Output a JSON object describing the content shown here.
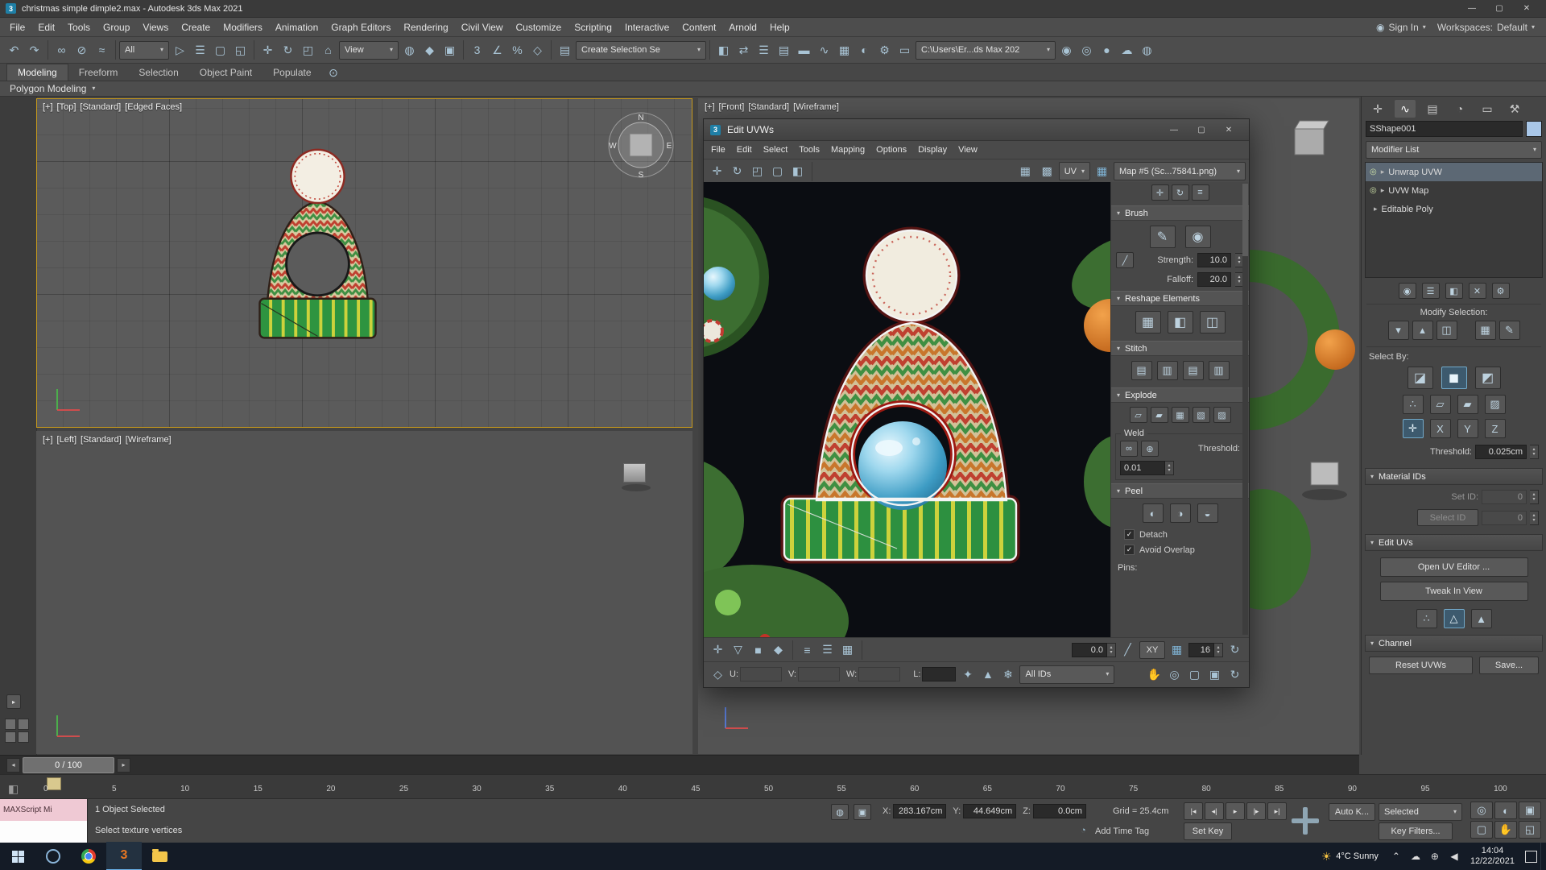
{
  "ui": {
    "caret": "▾",
    "caret_right": "▸",
    "check": "✓",
    "spin_up": "▴",
    "spin_down": "▾"
  },
  "window": {
    "title": "christmas simple dimple2.max - Autodesk 3ds Max 2021",
    "app_glyph": "3",
    "minimize": "—",
    "maximize": "▢",
    "close": "✕"
  },
  "menubar": {
    "items": [
      "File",
      "Edit",
      "Tools",
      "Group",
      "Views",
      "Create",
      "Modifiers",
      "Animation",
      "Graph Editors",
      "Rendering",
      "Civil View",
      "Customize",
      "Scripting",
      "Interactive",
      "Content",
      "Arnold",
      "Help"
    ],
    "sign_in": "Sign In",
    "sign_in_glyph": "◉",
    "workspaces_label": "Workspaces:",
    "workspaces_value": "Default"
  },
  "toolbar": {
    "icons_a": [
      {
        "n": "undo-icon",
        "g": "↶"
      },
      {
        "n": "redo-icon",
        "g": "↷"
      }
    ],
    "icons_b": [
      {
        "n": "select-and-link-icon",
        "g": "∞"
      },
      {
        "n": "unlink-selection-icon",
        "g": "⊘"
      },
      {
        "n": "bind-to-space-warp-icon",
        "g": "≈"
      }
    ],
    "filter_value": "All",
    "icons_c": [
      {
        "n": "select-object-icon",
        "g": "▷"
      },
      {
        "n": "select-by-name-icon",
        "g": "☰"
      },
      {
        "n": "rectangular-selection-icon",
        "g": "▢"
      },
      {
        "n": "window-crossing-icon",
        "g": "◱"
      }
    ],
    "icons_d": [
      {
        "n": "select-and-move-icon",
        "g": "✛"
      },
      {
        "n": "select-and-rotate-icon",
        "g": "↻"
      },
      {
        "n": "select-and-scale-icon",
        "g": "◰"
      },
      {
        "n": "select-and-place-icon",
        "g": "⌂"
      }
    ],
    "coord_value": "View",
    "icons_e": [
      {
        "n": "use-pivot-center-icon",
        "g": "◍"
      },
      {
        "n": "select-and-manipulate-icon",
        "g": "◆"
      },
      {
        "n": "keyboard-override-icon",
        "g": "▣"
      }
    ],
    "icons_f": [
      {
        "n": "snaps-toggle-icon",
        "g": "3"
      },
      {
        "n": "angle-snap-icon",
        "g": "∠"
      },
      {
        "n": "percent-snap-icon",
        "g": "%"
      },
      {
        "n": "spinner-snap-icon",
        "g": "◇"
      }
    ],
    "icons_g": [
      {
        "n": "named-selection-sets-icon",
        "g": "▤"
      }
    ],
    "selection_set_value": "Create Selection Se",
    "icons_h": [
      {
        "n": "mirror-icon",
        "g": "◧"
      },
      {
        "n": "align-icon",
        "g": "⇄"
      },
      {
        "n": "scene-explorer-icon",
        "g": "☰"
      },
      {
        "n": "layer-explorer-icon",
        "g": "▤"
      },
      {
        "n": "ribbon-toggle-icon",
        "g": "▬"
      },
      {
        "n": "curve-editor-icon",
        "g": "∿"
      },
      {
        "n": "schematic-view-icon",
        "g": "▦"
      },
      {
        "n": "material-editor-icon",
        "g": "◐"
      },
      {
        "n": "render-setup-icon",
        "g": "⚙"
      },
      {
        "n": "rendered-frame-icon",
        "g": "▭"
      }
    ],
    "project_path": "C:\\Users\\Er...ds Max 202",
    "icons_i": [
      {
        "n": "render-production-icon",
        "g": "◉"
      },
      {
        "n": "render-iterative-icon",
        "g": "◎"
      },
      {
        "n": "activeshade-icon",
        "g": "●"
      },
      {
        "n": "render-in-cloud-icon",
        "g": "☁"
      },
      {
        "n": "arnold-render-icon",
        "g": "◍"
      }
    ]
  },
  "ribbon": {
    "tabs": [
      {
        "label": "Modeling",
        "on": true
      },
      {
        "label": "Freeform",
        "on": false
      },
      {
        "label": "Selection",
        "on": false
      },
      {
        "label": "Object Paint",
        "on": false
      },
      {
        "label": "Populate",
        "on": false
      }
    ],
    "config_glyph": "⊙",
    "panel_title": "Polygon Modeling"
  },
  "viewports": {
    "top": [
      "[+]",
      "[Top]",
      "[Standard]",
      "[Edged Faces]"
    ],
    "left": [
      "[+]",
      "[Left]",
      "[Standard]",
      "[Wireframe]"
    ],
    "front": [
      "[+]",
      "[Front]",
      "[Standard]",
      "[Wireframe]"
    ],
    "viewcube": {
      "n": "N",
      "s": "S",
      "e": "E",
      "w": "W"
    }
  },
  "uv_editor": {
    "title": "Edit UVWs",
    "app_glyph": "3",
    "menu": [
      "File",
      "Edit",
      "Select",
      "Tools",
      "Mapping",
      "Options",
      "Display",
      "View"
    ],
    "toolbar_left": [
      {
        "n": "move-icon",
        "g": "✛"
      },
      {
        "n": "rotate-icon",
        "g": "↻"
      },
      {
        "n": "scale-icon",
        "g": "◰"
      },
      {
        "n": "freeform-gizmo-icon",
        "g": "▢"
      },
      {
        "n": "mirror-icon",
        "g": "◧"
      }
    ],
    "toolbar_right": [
      {
        "n": "show-map-toggle-icon",
        "g": "▦"
      },
      {
        "n": "tile-bitmap-icon",
        "g": "▩"
      }
    ],
    "uv_label": "UV",
    "checker_glyph": "▦",
    "map_value": "Map #5 (Sc...75841.png)",
    "panel": {
      "top_icons": [
        {
          "n": "align-horizontal-icon",
          "g": "✛"
        },
        {
          "n": "align-rotate-icon",
          "g": "↻"
        },
        {
          "n": "linear-align-icon",
          "g": "≡"
        }
      ],
      "brush_title": "Brush",
      "brush_icons": [
        {
          "n": "paint-move-brush-icon",
          "g": "✎"
        },
        {
          "n": "relax-brush-icon",
          "g": "◉"
        }
      ],
      "mirror_axis_glyph": "╱",
      "strength_label": "Strength:",
      "strength_value": "10.0",
      "falloff_label": "Falloff:",
      "falloff_value": "20.0",
      "reshape_title": "Reshape Elements",
      "reshape_icons": [
        {
          "n": "straighten-selection-icon",
          "g": "▦"
        },
        {
          "n": "make-rectangular-icon",
          "g": "◧"
        },
        {
          "n": "relax-element-icon",
          "g": "◫"
        }
      ],
      "stitch_title": "Stitch",
      "stitch_icons": [
        {
          "n": "stitch-custom-icon",
          "g": "▤"
        },
        {
          "n": "stitch-to-source-icon",
          "g": "▥"
        },
        {
          "n": "stitch-to-average-icon",
          "g": "▤"
        },
        {
          "n": "stitch-to-target-icon",
          "g": "▥"
        }
      ],
      "explode_title": "Explode",
      "explode_icons": [
        {
          "n": "flatten-by-angle-icon",
          "g": "▱"
        },
        {
          "n": "flatten-polygons-icon",
          "g": "▰"
        },
        {
          "n": "flatten-by-smoothing-icon",
          "g": "▦"
        },
        {
          "n": "flatten-by-material-icon",
          "g": "▧"
        },
        {
          "n": "explode-custom-icon",
          "g": "▨"
        }
      ],
      "weld_title": "Weld",
      "weld_icons": [
        {
          "n": "weld-selected-icon",
          "g": "∞"
        },
        {
          "n": "target-weld-icon",
          "g": "⊕"
        }
      ],
      "weld_threshold_label": "Threshold:",
      "weld_value": "0.01",
      "peel_title": "Peel",
      "peel_icons": [
        {
          "n": "quick-peel-icon",
          "g": "◐"
        },
        {
          "n": "peel-mode-icon",
          "g": "◑"
        },
        {
          "n": "pelt-map-icon",
          "g": "◒"
        }
      ],
      "detach_label": "Detach",
      "avoid_overlap_label": "Avoid Overlap",
      "pins_label": "Pins:"
    },
    "bottom1": {
      "icons_a": [
        {
          "n": "uvw-transform-gizmo-icon",
          "g": "✛"
        },
        {
          "n": "soft-selection-icon",
          "g": "▽"
        },
        {
          "n": "falloff-space-icon",
          "g": "■"
        },
        {
          "n": "falloff-type-icon",
          "g": "◆"
        }
      ],
      "icons_b": [
        {
          "n": "align-to-edge-icon",
          "g": "≡"
        },
        {
          "n": "distribute-icon",
          "g": "☰"
        },
        {
          "n": "pack-uvs-icon",
          "g": "▦"
        }
      ],
      "value": "0.0",
      "icons_c": [
        {
          "n": "edge-loop-mode-icon",
          "g": "╱"
        }
      ],
      "xy_label": "XY",
      "icons_d": [
        {
          "n": "grid-toggle-icon",
          "g": "▦"
        }
      ],
      "grid_value": "16",
      "icons_e": [
        {
          "n": "update-options-icon",
          "g": "↻"
        }
      ]
    },
    "bottom2": {
      "typein_glyph": "◇",
      "u_label": "U:",
      "u_value": "",
      "v_label": "V:",
      "v_value": "",
      "w_label": "W:",
      "w_value": "",
      "l_label": "L:",
      "l_value": "",
      "icons": [
        {
          "n": "lock-selection-icon",
          "g": "✦"
        },
        {
          "n": "filter-selected-faces-icon",
          "g": "▲"
        },
        {
          "n": "freeze-display-icon",
          "g": "❄"
        }
      ],
      "all_ids_value": "All IDs",
      "nav_icons": [
        {
          "n": "pan-hand-icon",
          "g": "✋"
        },
        {
          "n": "zoom-icon",
          "g": "◎"
        },
        {
          "n": "zoom-region-icon",
          "g": "▢"
        },
        {
          "n": "zoom-extents-icon",
          "g": "▣"
        },
        {
          "n": "zoom-to-selected-icon",
          "g": "↻"
        }
      ]
    }
  },
  "command_panel": {
    "tabs": [
      {
        "n": "create-tab-icon",
        "g": "✛",
        "on": false
      },
      {
        "n": "modify-tab-icon",
        "g": "∿",
        "on": true
      },
      {
        "n": "hierarchy-tab-icon",
        "g": "▤",
        "on": false
      },
      {
        "n": "motion-tab-icon",
        "g": "◔",
        "on": false
      },
      {
        "n": "display-tab-icon",
        "g": "▭",
        "on": false
      },
      {
        "n": "utilities-tab-icon",
        "g": "⚒",
        "on": false
      }
    ],
    "object_name": "SShape001",
    "modifier_list_label": "Modifier List",
    "stack": [
      {
        "label": "Unwrap UVW",
        "eye": "◎",
        "arrow": "▸",
        "on": true
      },
      {
        "label": "UVW Map",
        "eye": "◎",
        "arrow": "▸",
        "on": false
      },
      {
        "label": "Editable Poly",
        "eye": "",
        "arrow": "▸",
        "on": false
      }
    ],
    "stack_buttons": [
      {
        "n": "pin-stack-icon",
        "g": "◉"
      },
      {
        "n": "show-end-result-icon",
        "g": "☰"
      },
      {
        "n": "make-unique-icon",
        "g": "◧"
      },
      {
        "n": "remove-modifier-icon",
        "g": "✕"
      },
      {
        "n": "configure-modifier-sets-icon",
        "g": "⚙"
      }
    ],
    "modify_selection_label": "Modify Selection:",
    "modsel_icons_a": [
      {
        "n": "shrink-selection-icon",
        "g": "▾"
      },
      {
        "n": "grow-selection-icon",
        "g": "▴"
      },
      {
        "n": "ring-selection-icon",
        "g": "◫"
      }
    ],
    "modsel_icons_b": [
      {
        "n": "loop-selection-icon",
        "g": "▦"
      },
      {
        "n": "paint-select-icon",
        "g": "✎"
      }
    ],
    "select_by_label": "Select By:",
    "selby_row1": [
      {
        "n": "ignore-backfacing-icon",
        "g": "◪",
        "on": false
      },
      {
        "n": "select-element-cube-icon",
        "g": "◼",
        "on": true
      },
      {
        "n": "planar-angle-icon",
        "g": "◩",
        "on": false
      }
    ],
    "selby_row2": [
      {
        "n": "select-vertex-icon",
        "g": "∴",
        "on": false
      },
      {
        "n": "select-edge-icon",
        "g": "▱",
        "on": false
      },
      {
        "n": "select-polygon-icon",
        "g": "▰",
        "on": false
      },
      {
        "n": "select-matid-icon",
        "g": "▨",
        "on": false
      }
    ],
    "selby_row3": [
      {
        "n": "select-xy-icon",
        "g": "✛",
        "on": true
      },
      {
        "n": "x-axis-icon",
        "g": "X",
        "on": false
      },
      {
        "n": "y-axis-icon",
        "g": "Y",
        "on": false
      },
      {
        "n": "z-axis-icon",
        "g": "Z",
        "on": false
      }
    ],
    "threshold_label": "Threshold:",
    "threshold_value": "0.025cm",
    "material_ids_title": "Material IDs",
    "set_id_label": "Set ID:",
    "set_id_value": "0",
    "select_id_label": "Select ID",
    "select_id_value": "0",
    "edit_uvs_title": "Edit UVs",
    "open_uv_editor": "Open UV Editor ...",
    "tweak_in_view": "Tweak In View",
    "uvmode_icons": [
      {
        "n": "uv-vertex-mode-icon",
        "g": "∴",
        "on": false
      },
      {
        "n": "uv-edge-mode-icon",
        "g": "△",
        "on": true
      },
      {
        "n": "uv-face-mode-icon",
        "g": "▲",
        "on": false
      }
    ],
    "channel_title": "Channel",
    "reset_uvws": "Reset UVWs",
    "save": "Save..."
  },
  "timeline": {
    "frame_display": "0 / 100",
    "prev": "◂",
    "next": "▸",
    "trackbar_glyph": "◧",
    "ticks": [
      "0",
      "5",
      "10",
      "15",
      "20",
      "25",
      "30",
      "35",
      "40",
      "45",
      "50",
      "55",
      "60",
      "65",
      "70",
      "75",
      "80",
      "85",
      "90",
      "95",
      "100"
    ]
  },
  "statusbar": {
    "maxscript_title": "MAXScript Mi",
    "selection_info": "1 Object Selected",
    "prompt": "Select texture vertices",
    "isolate_glyph": "◍",
    "lock_glyph": "▣",
    "coords": [
      {
        "label": "X:",
        "value": "283.167cm"
      },
      {
        "label": "Y:",
        "value": "44.649cm"
      },
      {
        "label": "Z:",
        "value": "0.0cm"
      }
    ],
    "grid_info": "Grid = 25.4cm",
    "time_tag_glyph": "◔",
    "add_time_tag": "Add Time Tag",
    "playback": [
      {
        "n": "go-to-start-button",
        "g": "|◂"
      },
      {
        "n": "previous-frame-button",
        "g": "◂|"
      },
      {
        "n": "play-button",
        "g": "▸"
      },
      {
        "n": "next-frame-button",
        "g": "|▸"
      },
      {
        "n": "go-to-end-button",
        "g": "▸|"
      }
    ],
    "set_key": "Set Key",
    "auto_key": "Auto K...",
    "selected_mode": "Selected",
    "key_filters": "Key Filters...",
    "nav": [
      {
        "n": "zoom-icon",
        "g": "◎"
      },
      {
        "n": "zoom-all-icon",
        "g": "◐"
      },
      {
        "n": "zoom-extents-icon",
        "g": "▣"
      },
      {
        "n": "zoom-region-icon",
        "g": "▢"
      },
      {
        "n": "pan-hand-icon",
        "g": "✋"
      },
      {
        "n": "maximize-viewport-icon",
        "g": "◱"
      }
    ]
  },
  "taskbar": {
    "max_glyph": "3",
    "tray_chevron": "⌃",
    "sun_glyph": "☀",
    "weather": "4°C Sunny",
    "tray_icons": [
      {
        "n": "tray-cloud-icon",
        "g": "☁"
      },
      {
        "n": "tray-network-icon",
        "g": "⊕"
      },
      {
        "n": "tray-volume-icon",
        "g": "◀"
      }
    ],
    "time": "14:04",
    "date": "12/22/2021"
  }
}
